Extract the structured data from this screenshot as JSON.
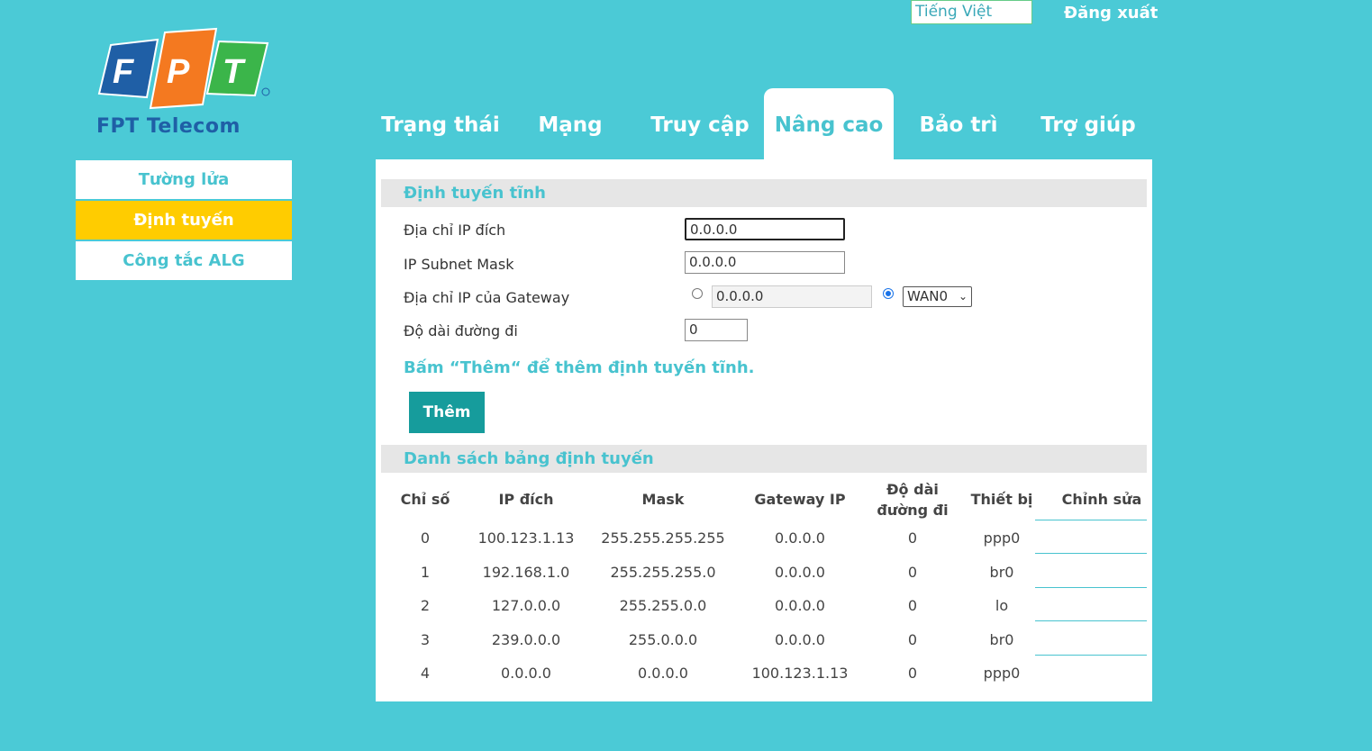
{
  "header": {
    "language": "Tiếng Việt",
    "logout": "Đăng xuất"
  },
  "logo": {
    "letters": [
      "F",
      "P",
      "T"
    ],
    "caption": "FPT Telecom",
    "colors": {
      "blue": "#1f5fa6",
      "orange": "#f47920",
      "green": "#3bb54a"
    }
  },
  "tabs": [
    {
      "label": "Trạng thái"
    },
    {
      "label": "Mạng"
    },
    {
      "label": "Truy cập"
    },
    {
      "label": "Nâng cao",
      "active": true
    },
    {
      "label": "Bảo trì"
    },
    {
      "label": "Trợ giúp"
    }
  ],
  "sidebar": {
    "items": [
      {
        "label": "Tường lửa"
      },
      {
        "label": "Định tuyến",
        "active": true
      },
      {
        "label": "Công tắc ALG"
      }
    ]
  },
  "static_route": {
    "title": "Định tuyến tĩnh",
    "fields": {
      "dest_ip": {
        "label": "Địa chỉ IP đích",
        "value": "0.0.0.0"
      },
      "subnet_mask": {
        "label": "IP Subnet Mask",
        "value": "0.0.0.0"
      },
      "gateway": {
        "label": "Địa chỉ IP của Gateway",
        "value": "0.0.0.0",
        "interface": "WAN0",
        "selected": "interface"
      },
      "metric": {
        "label": "Độ dài đường đi",
        "value": "0"
      }
    },
    "hint": "Bấm “Thêm“ để thêm định tuyến tĩnh.",
    "add_button": "Thêm"
  },
  "route_table": {
    "title": "Danh sách bảng định tuyến",
    "headers": {
      "index": "Chỉ số",
      "dest": "IP đích",
      "mask": "Mask",
      "gateway": "Gateway IP",
      "metric_1": "Độ dài",
      "metric_2": "đường đi",
      "device": "Thiết bị",
      "edit": "Chỉnh sửa"
    },
    "rows": [
      {
        "index": "0",
        "dest": "100.123.1.13",
        "mask": "255.255.255.255",
        "gateway": "0.0.0.0",
        "metric": "0",
        "device": "ppp0"
      },
      {
        "index": "1",
        "dest": "192.168.1.0",
        "mask": "255.255.255.0",
        "gateway": "0.0.0.0",
        "metric": "0",
        "device": "br0"
      },
      {
        "index": "2",
        "dest": "127.0.0.0",
        "mask": "255.255.0.0",
        "gateway": "0.0.0.0",
        "metric": "0",
        "device": "lo"
      },
      {
        "index": "3",
        "dest": "239.0.0.0",
        "mask": "255.0.0.0",
        "gateway": "0.0.0.0",
        "metric": "0",
        "device": "br0"
      },
      {
        "index": "4",
        "dest": "0.0.0.0",
        "mask": "0.0.0.0",
        "gateway": "100.123.1.13",
        "metric": "0",
        "device": "ppp0"
      }
    ]
  }
}
